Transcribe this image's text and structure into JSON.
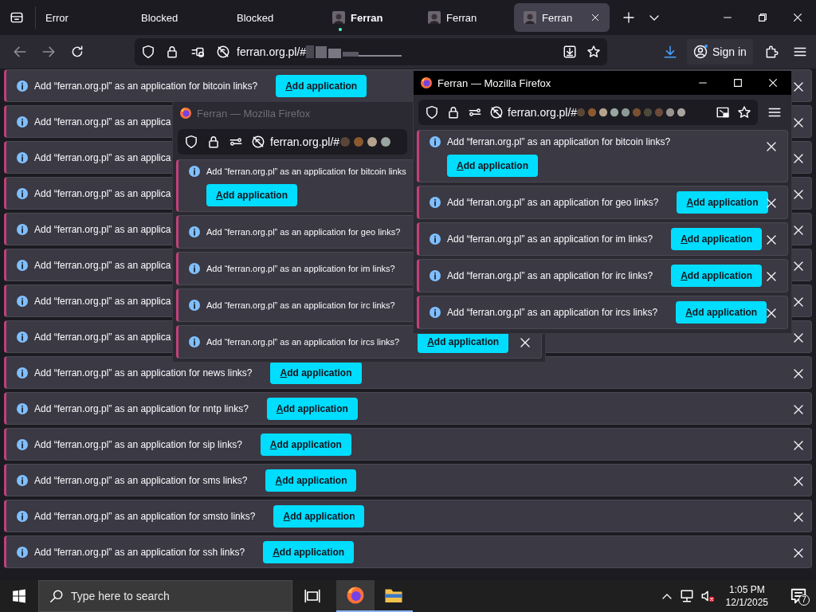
{
  "tab_bar": {
    "tabs": [
      {
        "label": "Error",
        "selected": false,
        "favicon": false,
        "attention": false
      },
      {
        "label": "Blocked",
        "selected": false,
        "favicon": false,
        "attention": false
      },
      {
        "label": "Blocked",
        "selected": false,
        "favicon": false,
        "attention": false
      },
      {
        "label": "Ferran",
        "selected": false,
        "favicon": true,
        "attention": true
      },
      {
        "label": "Ferran",
        "selected": false,
        "favicon": true,
        "attention": false
      },
      {
        "label": "Ferran",
        "selected": true,
        "favicon": true,
        "attention": false
      }
    ]
  },
  "nav_bar": {
    "url": "ferran.org.pl/#",
    "sign_in": "Sign in"
  },
  "notifications": [
    {
      "kind": "inline",
      "text": "Add “ferran.org.pl” as an application for bitcoin links?",
      "button": "Add application"
    },
    {
      "kind": "inline",
      "text": "Add “ferran.org.pl” as an applica"
    },
    {
      "kind": "inline",
      "text": "Add “ferran.org.pl” as an applica"
    },
    {
      "kind": "inline",
      "text": "Add “ferran.org.pl” as an applica"
    },
    {
      "kind": "inline",
      "text": "Add “ferran.org.pl” as an applica"
    },
    {
      "kind": "inline",
      "text": "Add “ferran.org.pl” as an applica"
    },
    {
      "kind": "inline",
      "text": "Add “ferran.org.pl” as an applica"
    },
    {
      "kind": "inline",
      "text": "Add “ferran.org.pl” as an applica"
    },
    {
      "kind": "inline",
      "text": "Add “ferran.org.pl” as an application for news links?",
      "button": "Add application"
    },
    {
      "kind": "inline",
      "text": "Add “ferran.org.pl” as an application for nntp links?",
      "button": "Add application"
    },
    {
      "kind": "inline",
      "text": "Add “ferran.org.pl” as an application for sip links?",
      "button": "Add application"
    },
    {
      "kind": "inline",
      "text": "Add “ferran.org.pl” as an application for sms links?",
      "button": "Add application"
    },
    {
      "kind": "inline",
      "text": "Add “ferran.org.pl” as an application for smsto links?",
      "button": "Add application"
    },
    {
      "kind": "inline",
      "text": "Add “ferran.org.pl” as an application for ssh links?",
      "button": "Add application"
    }
  ],
  "popup_windows": [
    {
      "title": "Ferran — Mozilla Firefox",
      "active": false,
      "url": "ferran.org.pl/#",
      "notifications": [
        {
          "kind": "stacked",
          "text": "Add “ferran.org.pl” as an application for bitcoin links",
          "button": "Add application"
        },
        {
          "kind": "inline",
          "text": "Add “ferran.org.pl” as an application for geo links?"
        },
        {
          "kind": "inline",
          "text": "Add “ferran.org.pl” as an application for im links?"
        },
        {
          "kind": "inline",
          "text": "Add “ferran.org.pl” as an application for irc links?"
        },
        {
          "kind": "inline",
          "text": "Add “ferran.org.pl” as an application for ircs links?",
          "button": "Add application"
        }
      ]
    },
    {
      "title": "Ferran — Mozilla Firefox",
      "active": true,
      "url": "ferran.org.pl/#",
      "notifications": [
        {
          "kind": "stacked",
          "text": "Add “ferran.org.pl” as an application for bitcoin links?",
          "button": "Add application"
        },
        {
          "kind": "inline",
          "text": "Add “ferran.org.pl” as an application for geo links?",
          "button": "Add application"
        },
        {
          "kind": "inline",
          "text": "Add “ferran.org.pl” as an application for im links?",
          "button": "Add application"
        },
        {
          "kind": "inline",
          "text": "Add “ferran.org.pl” as an application for irc links?",
          "button": "Add application"
        },
        {
          "kind": "inline",
          "text": "Add “ferran.org.pl” as an application for ircs links?",
          "button": "Add application"
        }
      ]
    }
  ],
  "taskbar": {
    "search_placeholder": "Type here to search",
    "time": "1:05 PM",
    "date": "12/1/2025",
    "notification_count": "7"
  }
}
